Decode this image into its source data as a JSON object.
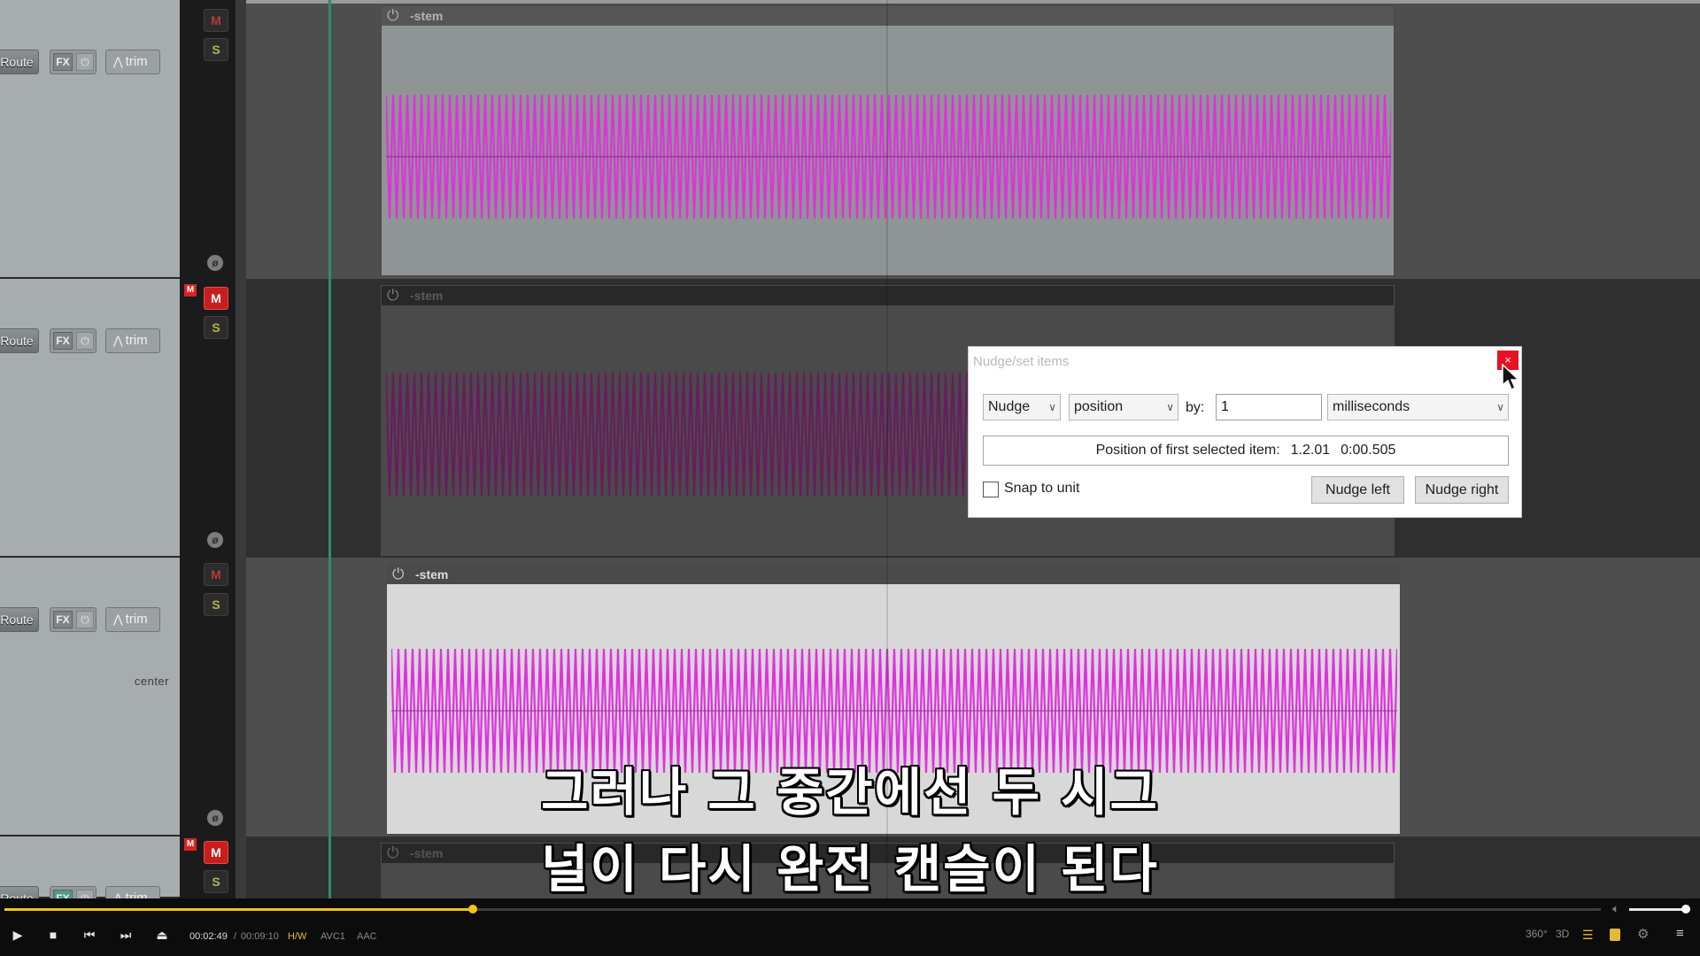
{
  "tracks": [
    {
      "route": "Route",
      "fx": "FX",
      "trim": "trim",
      "mute": "M",
      "solo": "S",
      "item_label": "-stem",
      "mute_on": false
    },
    {
      "route": "Route",
      "fx": "FX",
      "trim": "trim",
      "mute": "M",
      "solo": "S",
      "item_label": "-stem",
      "mute_on": true
    },
    {
      "route": "Route",
      "fx": "FX",
      "trim": "trim",
      "mute": "M",
      "solo": "S",
      "item_label": "-stem",
      "mute_on": false,
      "pan": "center"
    },
    {
      "route": "Route",
      "fx": "FX",
      "trim": "trim",
      "mute": "M",
      "solo": "S",
      "item_label": "-stem",
      "mute_on": true
    }
  ],
  "mute_flag": "M",
  "dialog": {
    "title": "Nudge/set items",
    "close": "×",
    "mode": "Nudge",
    "target": "position",
    "by_label": "by:",
    "amount": "1",
    "unit": "milliseconds",
    "position_label": "Position of first selected item:",
    "position_beats": "1.2.01",
    "position_time": "0:00.505",
    "snap_label": "Snap to unit",
    "snap_checked": false,
    "nudge_left": "Nudge left",
    "nudge_right": "Nudge right"
  },
  "subtitles": {
    "line1": "그러나 그 중간에선 두 시그",
    "line2": "널이 다시 완전 캔슬이 된다"
  },
  "player": {
    "current_time": "00:02:49",
    "separator": "/",
    "total_time": "00:09:10",
    "hw": "H/W",
    "video_codec": "AVC1",
    "audio_codec": "AAC",
    "progress": 0.2933,
    "volume": 0.9,
    "right_tags": [
      "360°",
      "3D"
    ]
  },
  "colors": {
    "waveform": "#e030e0",
    "waveform_muted": "#6a1a60",
    "item_bg_active": "#8f9594",
    "item_bg_muted": "#4a4a4a",
    "item_bg_selected": "#d8d8d8",
    "accent": "#f2c21a"
  }
}
